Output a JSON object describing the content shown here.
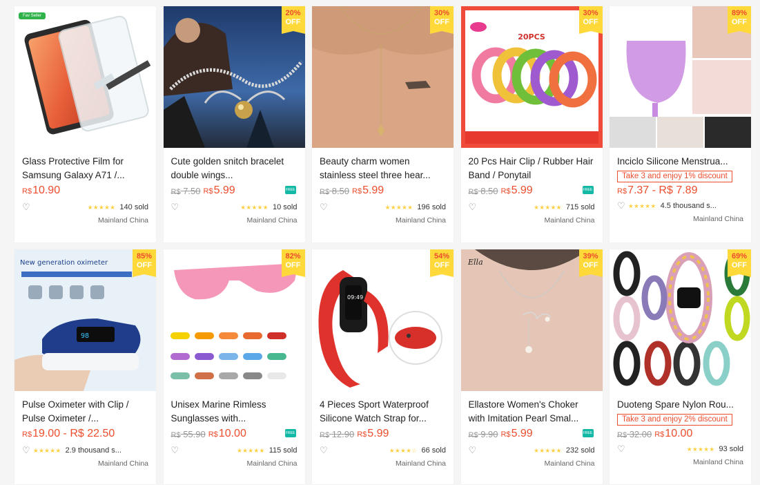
{
  "products": [
    {
      "name": "Glass Protective Film for Samsung Galaxy A71 /...",
      "currency": "R$",
      "old_price": "",
      "price": "10.90",
      "promo": "",
      "rating": 5,
      "sold": "140 sold",
      "location": "Mainland China",
      "discount": "",
      "off": "",
      "free_shipping": false,
      "fav_tag": "Fav Seller"
    },
    {
      "name": "Cute golden snitch bracelet double wings...",
      "currency": "R$",
      "old_price": "7.50",
      "price": "5.99",
      "promo": "",
      "rating": 5,
      "sold": "10 sold",
      "location": "Mainland China",
      "discount": "20%",
      "off": "OFF",
      "free_shipping": true
    },
    {
      "name": "Beauty charm women stainless steel three hear...",
      "currency": "R$",
      "old_price": "8.50",
      "price": "5.99",
      "promo": "",
      "rating": 5,
      "sold": "196 sold",
      "location": "Mainland China",
      "discount": "30%",
      "off": "OFF",
      "free_shipping": false
    },
    {
      "name": "20 Pcs Hair Clip / Rubber Hair Band / Ponytail",
      "currency": "R$",
      "old_price": "8.50",
      "price": "5.99",
      "promo": "",
      "rating": 5,
      "sold": "715 sold",
      "location": "Mainland China",
      "discount": "30%",
      "off": "OFF",
      "free_shipping": true,
      "image_text": "20PCS"
    },
    {
      "name": "Inciclo Silicone Menstrua...",
      "currency": "R$",
      "old_price": "",
      "price": "7.37 - R$ 7.89",
      "promo": "Take 3 and enjoy 1% discount",
      "rating": 5,
      "sold": "4.5 thousand s...",
      "location": "Mainland China",
      "discount": "89%",
      "off": "OFF",
      "free_shipping": false
    },
    {
      "name": "Pulse Oximeter with Clip / Pulse Oximeter /...",
      "currency": "R$",
      "old_price": "",
      "price": "19.00 - R$ 22.50",
      "promo": "",
      "rating": 5,
      "sold": "2.9 thousand s...",
      "location": "Mainland China",
      "discount": "85%",
      "off": "OFF",
      "free_shipping": false,
      "image_text": "New generation oximeter"
    },
    {
      "name": "Unisex Marine Rimless Sunglasses with...",
      "currency": "R$",
      "old_price": "55.90",
      "price": "10.00",
      "promo": "",
      "rating": 5,
      "sold": "115 sold",
      "location": "Mainland China",
      "discount": "82%",
      "off": "OFF",
      "free_shipping": true
    },
    {
      "name": "4 Pieces Sport Waterproof Silicone Watch Strap for...",
      "currency": "R$",
      "old_price": "12.90",
      "price": "5.99",
      "promo": "",
      "rating": 4,
      "sold": "66 sold",
      "location": "Mainland China",
      "discount": "54%",
      "off": "OFF",
      "free_shipping": false
    },
    {
      "name": "Ellastore Women's Choker with Imitation Pearl Smal...",
      "currency": "R$",
      "old_price": "9.90",
      "price": "5.99",
      "promo": "",
      "rating": 5,
      "sold": "232 sold",
      "location": "Mainland China",
      "discount": "39%",
      "off": "OFF",
      "free_shipping": true,
      "image_text": "Ella"
    },
    {
      "name": "Duoteng Spare Nylon Rou...",
      "currency": "R$",
      "old_price": "32.00",
      "price": "10.00",
      "promo": "Take 3 and enjoy 2% discount",
      "rating": 5,
      "sold": "93 sold",
      "location": "Mainland China",
      "discount": "69%",
      "off": "OFF",
      "free_shipping": false
    }
  ],
  "colors": {
    "accent": "#ee4d2d",
    "badge": "#ffd839",
    "star": "#ffce3d"
  },
  "icons": {
    "heart": "heart-outline-icon",
    "star": "star-icon",
    "free": "free-shipping-icon"
  }
}
